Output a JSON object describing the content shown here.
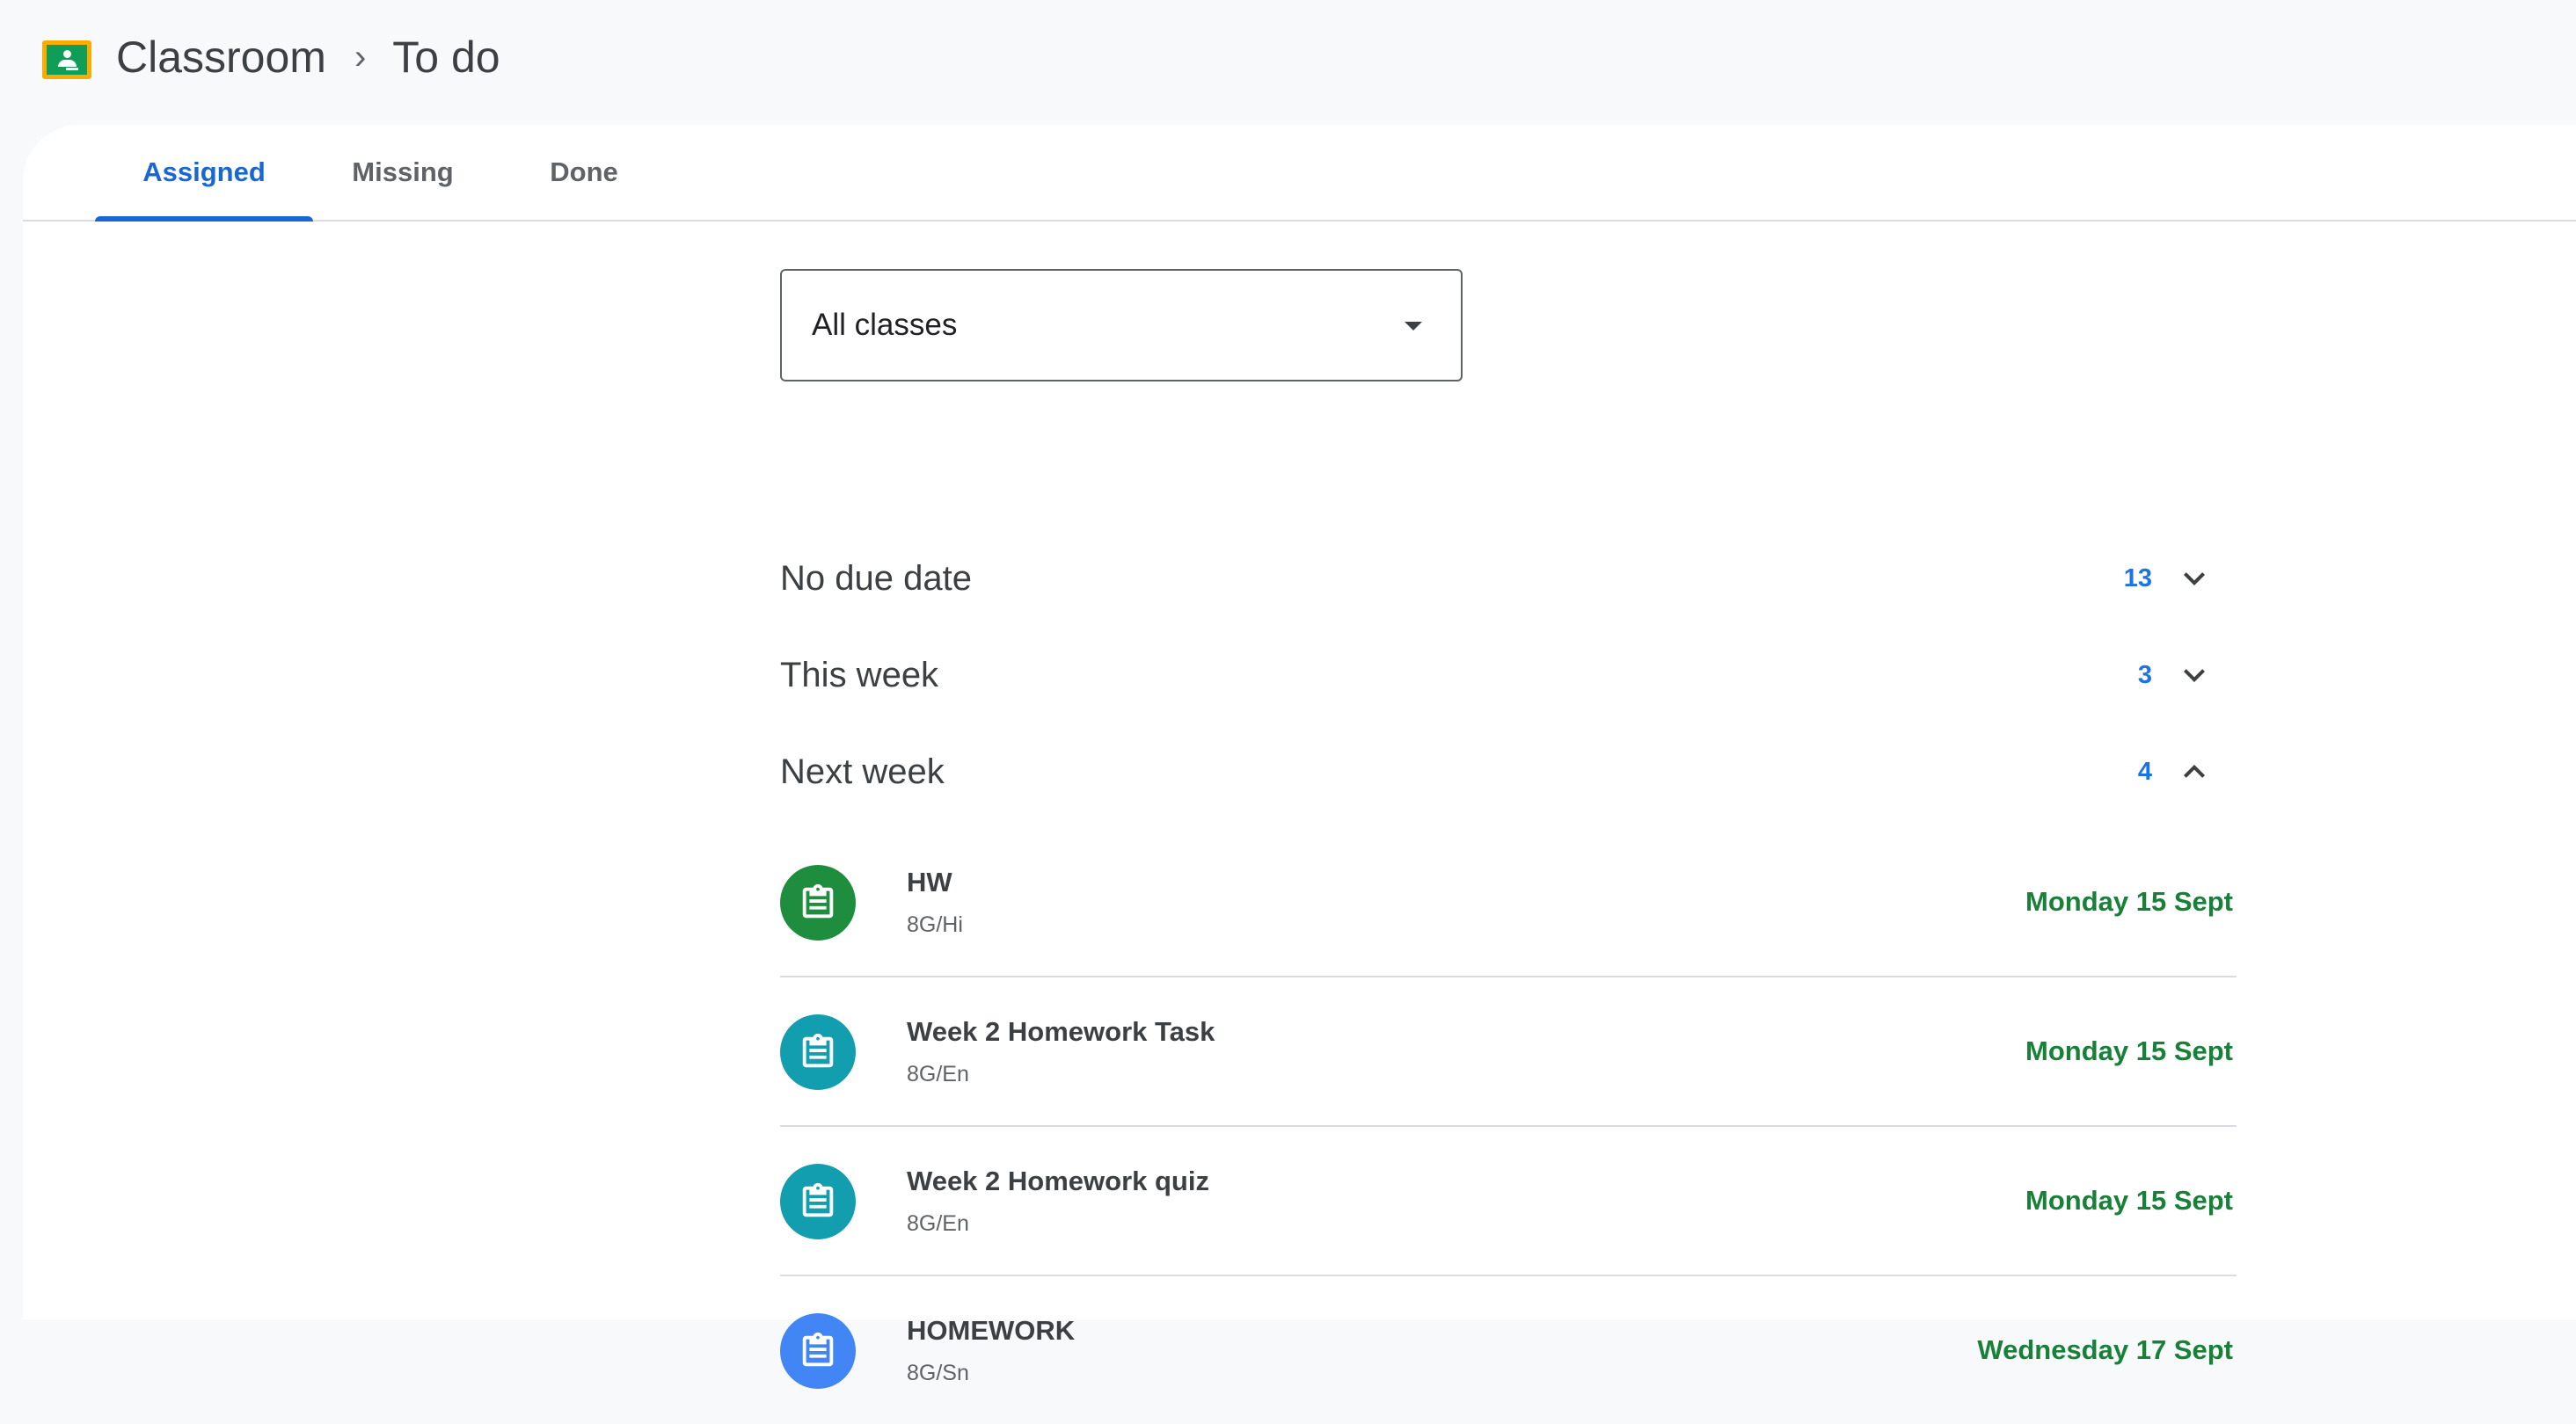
{
  "header": {
    "app_name": "Classroom",
    "separator": "›",
    "page": "To do"
  },
  "tabs": [
    {
      "label": "Assigned",
      "active": true
    },
    {
      "label": "Missing",
      "active": false
    },
    {
      "label": "Done",
      "active": false
    }
  ],
  "filter": {
    "selected": "All classes"
  },
  "sections": [
    {
      "title": "No due date",
      "count": "13",
      "expanded": false
    },
    {
      "title": "This week",
      "count": "3",
      "expanded": false
    },
    {
      "title": "Next week",
      "count": "4",
      "expanded": true
    }
  ],
  "tasks": [
    {
      "title": "HW",
      "class": "8G/Hi",
      "due": "Monday 15 Sept",
      "color": "#1e8e3e"
    },
    {
      "title": "Week 2 Homework Task",
      "class": "8G/En",
      "due": "Monday 15 Sept",
      "color": "#129eaf"
    },
    {
      "title": "Week 2 Homework quiz",
      "class": "8G/En",
      "due": "Monday 15 Sept",
      "color": "#129eaf"
    },
    {
      "title": "HOMEWORK",
      "class": "8G/Sn",
      "due": "Wednesday 17 Sept",
      "color": "#4285f4"
    }
  ],
  "icons": {
    "logo": "google-classroom-logo",
    "task": "assignment-clipboard-icon",
    "collapsed": "chevron-down-icon",
    "expanded": "chevron-up-icon",
    "dropdown": "caret-down-icon"
  },
  "colors": {
    "accent": "#1967d2",
    "count": "#1a73e8",
    "due": "#188038"
  }
}
